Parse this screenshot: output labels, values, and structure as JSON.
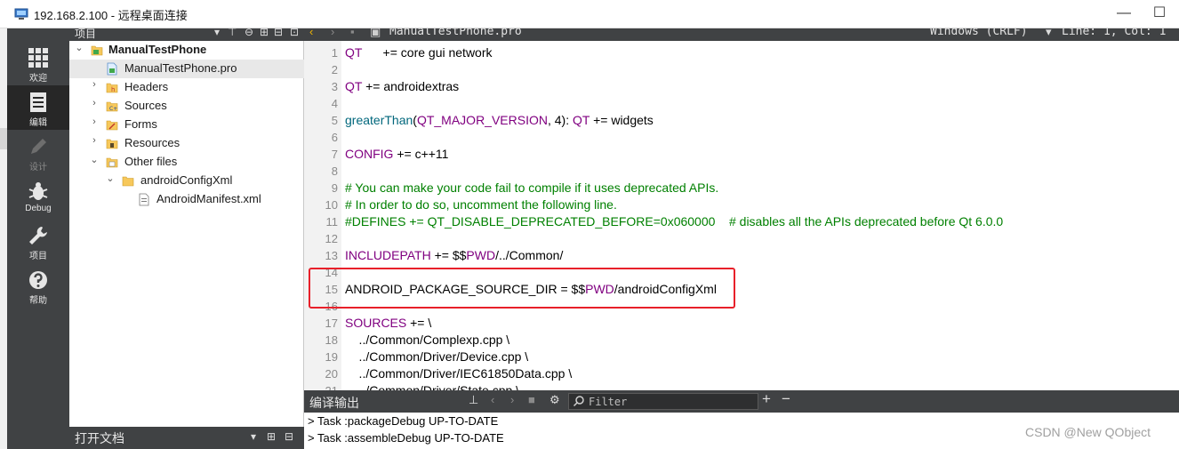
{
  "window": {
    "title": "192.168.2.100 - 远程桌面连接",
    "min_symbol": "—",
    "max_symbol": "☐"
  },
  "modes": [
    {
      "label": "欢迎",
      "icon": "grid-icon",
      "state": "normal"
    },
    {
      "label": "编辑",
      "icon": "document-icon",
      "state": "active"
    },
    {
      "label": "设计",
      "icon": "pencil-icon",
      "state": "disabled"
    },
    {
      "label": "Debug",
      "icon": "bug-icon",
      "state": "normal"
    },
    {
      "label": "项目",
      "icon": "wrench-icon",
      "state": "normal"
    },
    {
      "label": "帮助",
      "icon": "help-icon",
      "state": "normal"
    }
  ],
  "project_panel": {
    "title": "项目",
    "tree": [
      {
        "label": "ManualTestPhone",
        "level": 0,
        "expanded": true,
        "icon": "project-folder-icon",
        "bold": true
      },
      {
        "label": "ManualTestPhone.pro",
        "level": 1,
        "icon": "pro-file-icon",
        "selected": true
      },
      {
        "label": "Headers",
        "level": 1,
        "expanded": false,
        "icon": "headers-folder-icon"
      },
      {
        "label": "Sources",
        "level": 1,
        "expanded": false,
        "icon": "sources-folder-icon"
      },
      {
        "label": "Forms",
        "level": 1,
        "expanded": false,
        "icon": "forms-folder-icon"
      },
      {
        "label": "Resources",
        "level": 1,
        "expanded": false,
        "icon": "resources-folder-icon"
      },
      {
        "label": "Other files",
        "level": 1,
        "expanded": true,
        "icon": "other-files-folder-icon"
      },
      {
        "label": "androidConfigXml",
        "level": 2,
        "expanded": true,
        "icon": "folder-icon"
      },
      {
        "label": "AndroidManifest.xml",
        "level": 3,
        "icon": "xml-file-icon"
      }
    ]
  },
  "open_docs": {
    "title": "打开文档"
  },
  "editor_toolbar": {
    "file_name": "ManualTestPhone.pro",
    "line_ending": "Windows (CRLF)",
    "position": "Line: 1, Col: 1"
  },
  "code_lines": [
    {
      "n": "1",
      "parts": [
        {
          "t": "QT",
          "c": "kw"
        },
        {
          "t": "      += core gui network",
          "c": "pl"
        }
      ]
    },
    {
      "n": "2",
      "parts": []
    },
    {
      "n": "3",
      "parts": [
        {
          "t": "QT",
          "c": "kw"
        },
        {
          "t": " += androidextras",
          "c": "pl"
        }
      ]
    },
    {
      "n": "4",
      "parts": []
    },
    {
      "n": "5",
      "parts": [
        {
          "t": "greaterThan",
          "c": "fn"
        },
        {
          "t": "(",
          "c": "pl"
        },
        {
          "t": "QT_MAJOR_VERSION",
          "c": "kw"
        },
        {
          "t": ", 4): ",
          "c": "pl"
        },
        {
          "t": "QT",
          "c": "kw"
        },
        {
          "t": " += widgets",
          "c": "pl"
        }
      ]
    },
    {
      "n": "6",
      "parts": []
    },
    {
      "n": "7",
      "parts": [
        {
          "t": "CONFIG",
          "c": "kw"
        },
        {
          "t": " += c++11",
          "c": "pl"
        }
      ]
    },
    {
      "n": "8",
      "parts": []
    },
    {
      "n": "9",
      "parts": [
        {
          "t": "# You can make your code fail to compile if it uses deprecated APIs.",
          "c": "cm"
        }
      ]
    },
    {
      "n": "10",
      "parts": [
        {
          "t": "# In order to do so, uncomment the following line.",
          "c": "cm"
        }
      ]
    },
    {
      "n": "11",
      "parts": [
        {
          "t": "#DEFINES += QT_DISABLE_DEPRECATED_BEFORE=0x060000    # disables all the APIs deprecated before Qt 6.0.0",
          "c": "cm"
        }
      ]
    },
    {
      "n": "12",
      "parts": []
    },
    {
      "n": "13",
      "parts": [
        {
          "t": "INCLUDEPATH",
          "c": "kw"
        },
        {
          "t": " += $$",
          "c": "pl"
        },
        {
          "t": "PWD",
          "c": "kw"
        },
        {
          "t": "/../Common/",
          "c": "pl"
        }
      ]
    },
    {
      "n": "14",
      "parts": []
    },
    {
      "n": "15",
      "parts": [
        {
          "t": "ANDROID_PACKAGE_SOURCE_DIR = $$",
          "c": "pl"
        },
        {
          "t": "PWD",
          "c": "kw"
        },
        {
          "t": "/androidConfigXml",
          "c": "pl"
        }
      ]
    },
    {
      "n": "16",
      "parts": []
    },
    {
      "n": "17",
      "parts": [
        {
          "t": "SOURCES",
          "c": "kw"
        },
        {
          "t": " += \\",
          "c": "pl"
        }
      ]
    },
    {
      "n": "18",
      "parts": [
        {
          "t": "    ../Common/Complexp.cpp \\",
          "c": "pl"
        }
      ]
    },
    {
      "n": "19",
      "parts": [
        {
          "t": "    ../Common/Driver/Device.cpp \\",
          "c": "pl"
        }
      ]
    },
    {
      "n": "20",
      "parts": [
        {
          "t": "    ../Common/Driver/IEC61850Data.cpp \\",
          "c": "pl"
        }
      ]
    },
    {
      "n": "21",
      "parts": [
        {
          "t": "    ../Common/Driver/State.cpp \\",
          "c": "pl"
        }
      ]
    }
  ],
  "output_panel": {
    "title": "编译输出",
    "filter_placeholder": "Filter",
    "lines": [
      "> Task :packageDebug UP-TO-DATE",
      "> Task :assembleDebug UP-TO-DATE"
    ]
  },
  "watermark": "CSDN @New QObject",
  "colors": {
    "keyword": "#800080",
    "function": "#00677c",
    "comment": "#008000",
    "highlight_box": "#e8202a",
    "panel_dark": "#404244"
  }
}
